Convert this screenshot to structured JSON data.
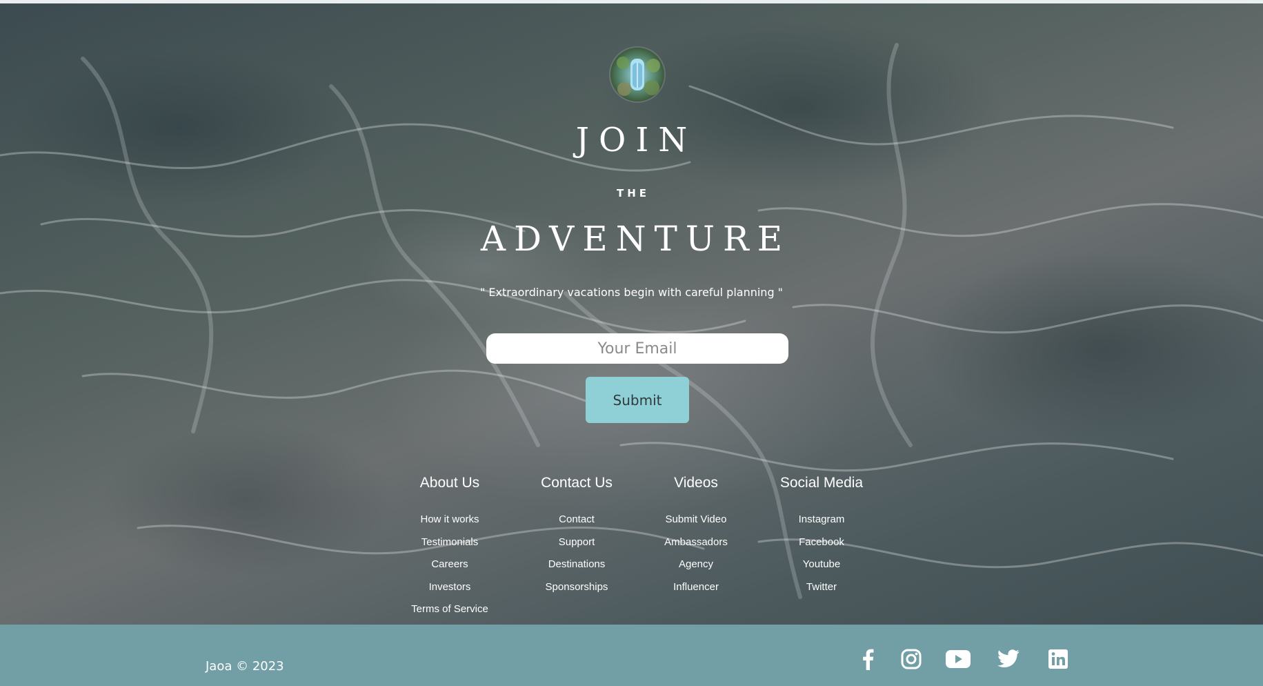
{
  "hero": {
    "headline_line1": "JOIN",
    "headline_line2": "THE",
    "headline_line3": "ADVENTURE",
    "tagline": "\" Extraordinary vacations begin with careful planning \"",
    "email_placeholder": "Your Email",
    "submit_label": "Submit"
  },
  "footer": {
    "columns": [
      {
        "title": "About Us",
        "links": [
          "How it works",
          "Testimonials",
          "Careers",
          "Investors",
          "Terms of Service"
        ]
      },
      {
        "title": "Contact Us",
        "links": [
          "Contact",
          "Support",
          "Destinations",
          "Sponsorships"
        ]
      },
      {
        "title": "Videos",
        "links": [
          "Submit Video",
          "Ambassadors",
          "Agency",
          "Influencer"
        ]
      },
      {
        "title": "Social Media",
        "links": [
          "Instagram",
          "Facebook",
          "Youtube",
          "Twitter"
        ]
      }
    ]
  },
  "bottom_bar": {
    "copyright": "Jaoa © 2023",
    "social_icons": [
      "facebook-icon",
      "instagram-icon",
      "youtube-icon",
      "twitter-icon",
      "linkedin-icon"
    ]
  },
  "colors": {
    "submit_button": "#8fd0d6",
    "bottom_bar": "#719fa5",
    "text": "#ffffff"
  }
}
